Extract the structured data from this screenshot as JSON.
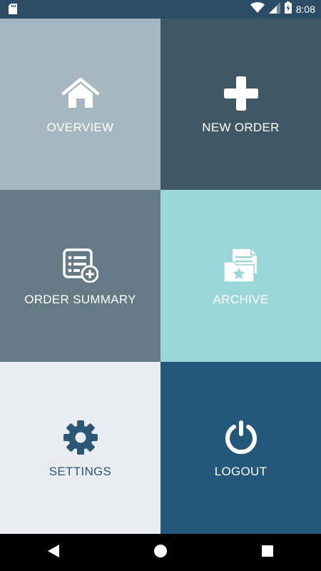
{
  "status_bar": {
    "time": "8:08",
    "icons": [
      "sd-card-icon",
      "wifi-icon",
      "signal-icon",
      "battery-charging-icon"
    ],
    "background": "#2c4c66"
  },
  "tiles": [
    {
      "label": "OVERVIEW",
      "icon": "home-icon",
      "background": "#a6b7c1"
    },
    {
      "label": "NEW ORDER",
      "icon": "plus-icon",
      "background": "#405866"
    },
    {
      "label": "ORDER SUMMARY",
      "icon": "list-add-icon",
      "background": "#647a85"
    },
    {
      "label": "ARCHIVE",
      "icon": "folder-star-icon",
      "background": "#9ad7d8"
    },
    {
      "label": "SETTINGS",
      "icon": "gear-icon",
      "background": "#e9edf1"
    },
    {
      "label": "LOGOUT",
      "icon": "power-icon",
      "background": "#24587b"
    }
  ],
  "nav_bar": {
    "buttons": [
      "back-icon",
      "home-circle-icon",
      "recents-icon"
    ]
  }
}
